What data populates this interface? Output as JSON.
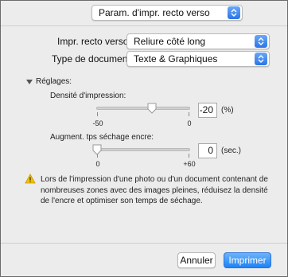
{
  "top_popup": {
    "value": "Param. d'impr. recto verso"
  },
  "duplex": {
    "label": "Impr. recto verso:",
    "value": "Reliure côté long"
  },
  "doc_type": {
    "label": "Type de document:",
    "value": "Texte & Graphiques"
  },
  "settings": {
    "header": "Réglages:",
    "density": {
      "label": "Densité d'impression:",
      "value": "-20",
      "unit": "(%)",
      "min_label": "-50",
      "max_label": "0",
      "min": -50,
      "max": 0,
      "current": -20
    },
    "drying": {
      "label": "Augment. tps séchage encre:",
      "value": "0",
      "unit": "(sec.)",
      "min_label": "0",
      "max_label": "+60",
      "min": 0,
      "max": 60,
      "current": 0
    }
  },
  "note": {
    "icon": "warning-icon",
    "text": "Lors de l'impression d'une photo ou d'un document contenant de nombreuses zones avec des images pleines, réduisez la densité de l'encre et optimiser son temps de séchage."
  },
  "buttons": {
    "cancel": "Annuler",
    "print": "Imprimer"
  },
  "colors": {
    "accent": "#1e82f5",
    "panel_bg": "#ececec",
    "warning": "#f2c200"
  }
}
